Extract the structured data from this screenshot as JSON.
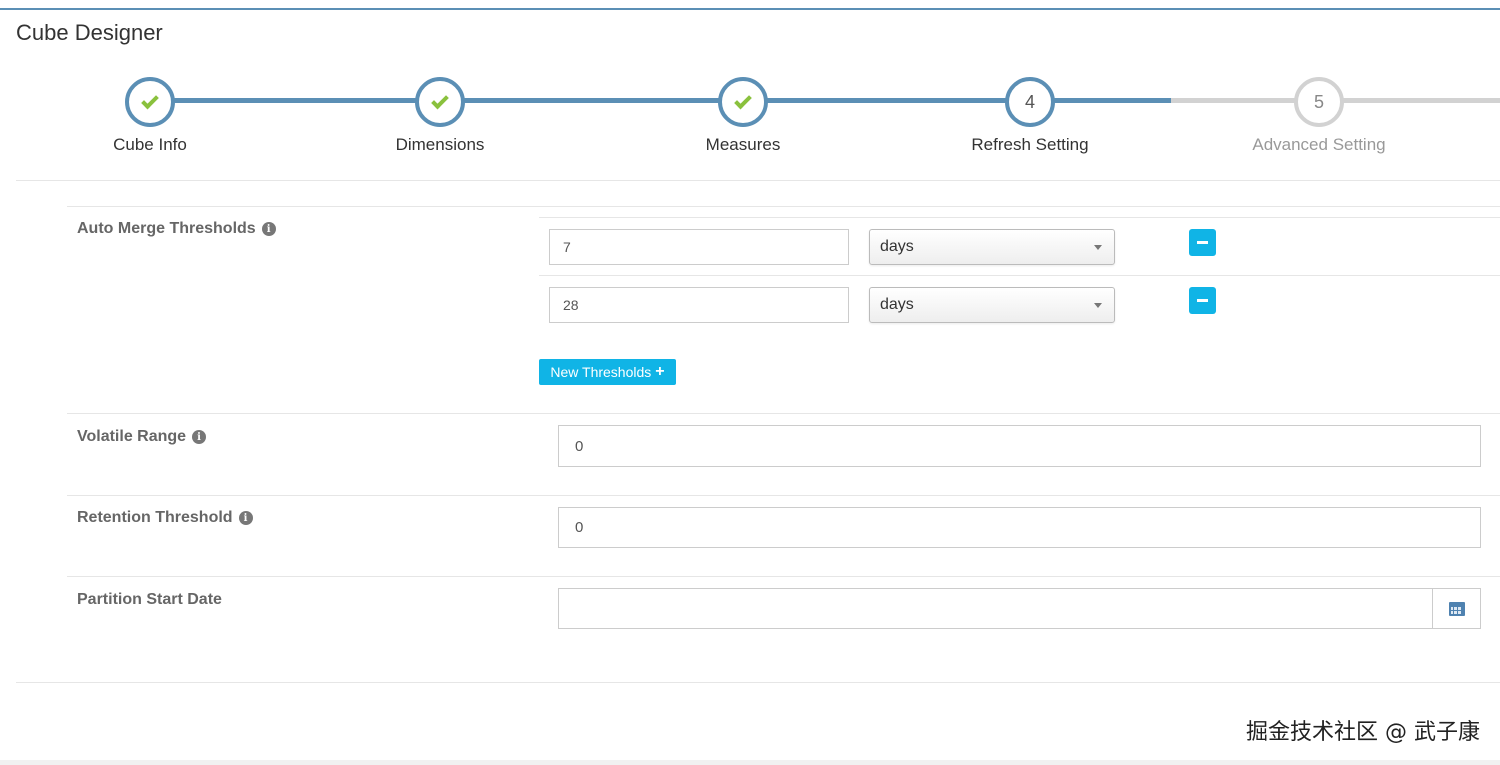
{
  "app": {
    "title": "Cube Designer"
  },
  "wizard": {
    "steps": [
      {
        "label": "Cube Info",
        "status": "done"
      },
      {
        "label": "Dimensions",
        "status": "done"
      },
      {
        "label": "Measures",
        "status": "done"
      },
      {
        "label": "Refresh Setting",
        "status": "current",
        "number": "4"
      },
      {
        "label": "Advanced Setting",
        "status": "todo",
        "number": "5"
      }
    ]
  },
  "form": {
    "auto_merge": {
      "label": "Auto Merge Thresholds",
      "rows": [
        {
          "value": "7",
          "unit": "days"
        },
        {
          "value": "28",
          "unit": "days"
        }
      ],
      "new_button_label": "New Thresholds"
    },
    "volatile_range": {
      "label": "Volatile Range",
      "value": "0"
    },
    "retention_threshold": {
      "label": "Retention Threshold",
      "value": "0"
    },
    "partition_start_date": {
      "label": "Partition Start Date",
      "value": ""
    }
  },
  "icons": {
    "info": "info-icon",
    "check": "check-icon",
    "minus": "minus-icon",
    "plus": "plus-icon",
    "calendar": "calendar-icon",
    "dropdown": "chevron-down-icon"
  },
  "colors": {
    "accent": "#10b4e6",
    "step_done": "#5b8fb5",
    "check_green": "#8ac13d",
    "step_todo": "#d2d2d2"
  },
  "watermark": {
    "text": "掘金技术社区 @ 武子康"
  }
}
